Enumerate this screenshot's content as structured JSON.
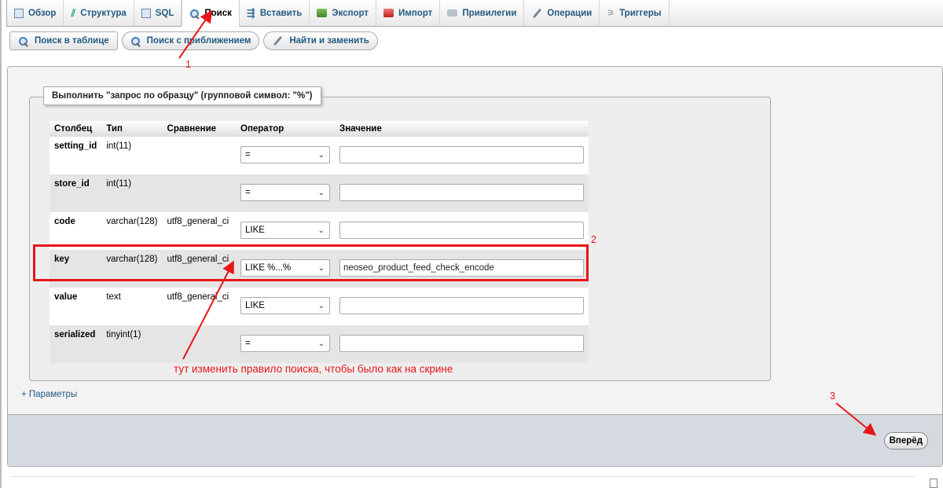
{
  "tabs": [
    {
      "label": "Обзор",
      "icon": "table-icon"
    },
    {
      "label": "Структура",
      "icon": "structure-icon"
    },
    {
      "label": "SQL",
      "icon": "sql-icon"
    },
    {
      "label": "Поиск",
      "icon": "search-icon",
      "active": true
    },
    {
      "label": "Вставить",
      "icon": "insert-icon"
    },
    {
      "label": "Экспорт",
      "icon": "export-icon"
    },
    {
      "label": "Импорт",
      "icon": "import-icon"
    },
    {
      "label": "Привилегии",
      "icon": "privileges-icon"
    },
    {
      "label": "Операции",
      "icon": "wrench-icon"
    },
    {
      "label": "Триггеры",
      "icon": "triggers-icon"
    }
  ],
  "subtabs": [
    {
      "label": "Поиск в таблице"
    },
    {
      "label": "Поиск с приближением"
    },
    {
      "label": "Найти и заменить"
    }
  ],
  "query_legend": "Выполнить \"запрос по образцу\" (групповой символ: \"%\")",
  "headers": {
    "column": "Столбец",
    "type": "Тип",
    "collation": "Сравнение",
    "operator": "Оператор",
    "value": "Значение"
  },
  "rows": [
    {
      "name": "setting_id",
      "type": "int(11)",
      "collation": "",
      "operator": "=",
      "value": ""
    },
    {
      "name": "store_id",
      "type": "int(11)",
      "collation": "",
      "operator": "=",
      "value": ""
    },
    {
      "name": "code",
      "type": "varchar(128)",
      "collation": "utf8_general_ci",
      "operator": "LIKE",
      "value": ""
    },
    {
      "name": "key",
      "type": "varchar(128)",
      "collation": "utf8_general_ci",
      "operator": "LIKE %...%",
      "value": "neoseo_product_feed_check_encode"
    },
    {
      "name": "value",
      "type": "text",
      "collation": "utf8_general_ci",
      "operator": "LIKE",
      "value": ""
    },
    {
      "name": "serialized",
      "type": "tinyint(1)",
      "collation": "",
      "operator": "=",
      "value": ""
    }
  ],
  "params_link": "+ Параметры",
  "go_button": "Вперёд",
  "annotations": {
    "num1": "1",
    "num2": "2",
    "num3": "3",
    "note": "тут изменить правило поиска, чтобы было как на скрине",
    "color": "#e8161a"
  }
}
